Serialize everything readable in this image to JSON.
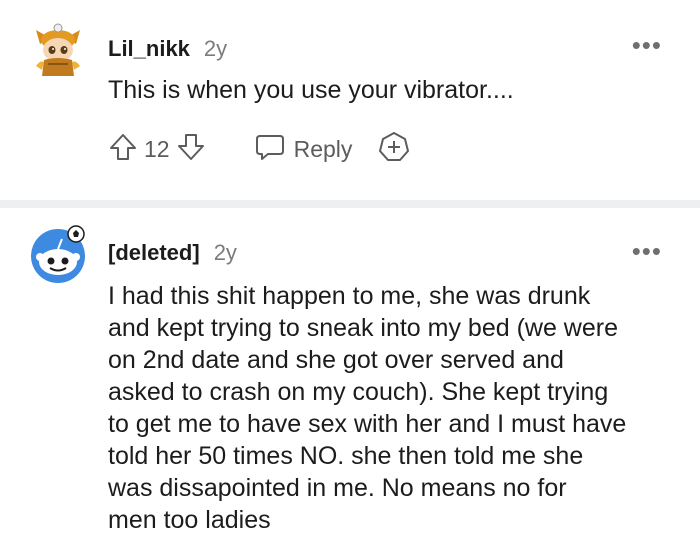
{
  "comments": [
    {
      "username": "Lil_nikk",
      "time": "2y",
      "body": "This is when you use your vibrator....",
      "score": "12",
      "reply_label": "Reply",
      "icons": [
        "snoo-avatar",
        "upvote-icon",
        "downvote-icon",
        "reply-icon",
        "award-icon",
        "more-icon"
      ]
    },
    {
      "username": "[deleted]",
      "time": "2y",
      "body": "I had this shit happen to me, she was drunk\nand kept trying to sneak into my bed (we were\non 2nd date and she got over served and\nasked to crash on my couch). She kept trying\nto get me to have sex with her and I must have\ntold her 50 times NO. she then told me she\nwas dissapointed in me. No means no for\nmen too ladies",
      "icons": [
        "default-avatar",
        "more-icon"
      ]
    }
  ],
  "colors": {
    "divider": "#edeff1",
    "text": "#1c1c1c",
    "muted": "#7c7c7c",
    "avatar_blue": "#3d8ae0"
  }
}
